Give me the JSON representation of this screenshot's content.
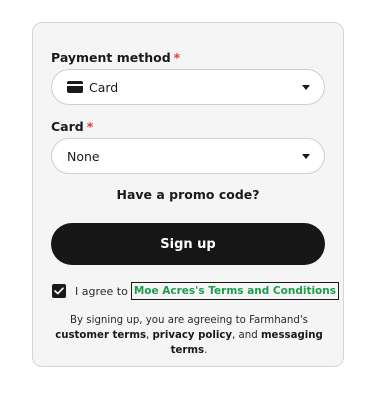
{
  "payment_method": {
    "label": "Payment method",
    "required_mark": "*",
    "selected": "Card",
    "icon": "credit-card-icon"
  },
  "card": {
    "label": "Card",
    "required_mark": "*",
    "selected": "None"
  },
  "promo": {
    "text": "Have a promo code?"
  },
  "signup": {
    "label": "Sign up"
  },
  "agreement": {
    "checked": true,
    "prefix": "I agree to",
    "link": "Moe Acres's Terms and Conditions"
  },
  "disclaimer": {
    "lead": "By signing up, you are agreeing to Farmhand's",
    "customer_terms": "customer terms",
    "sep1": ",",
    "privacy_policy": "privacy policy",
    "sep2": ", and",
    "messaging_terms": "messaging terms",
    "end": "."
  },
  "colors": {
    "link_green": "#1b9e4b",
    "required_red": "#e53935",
    "button_dark": "#161616"
  }
}
